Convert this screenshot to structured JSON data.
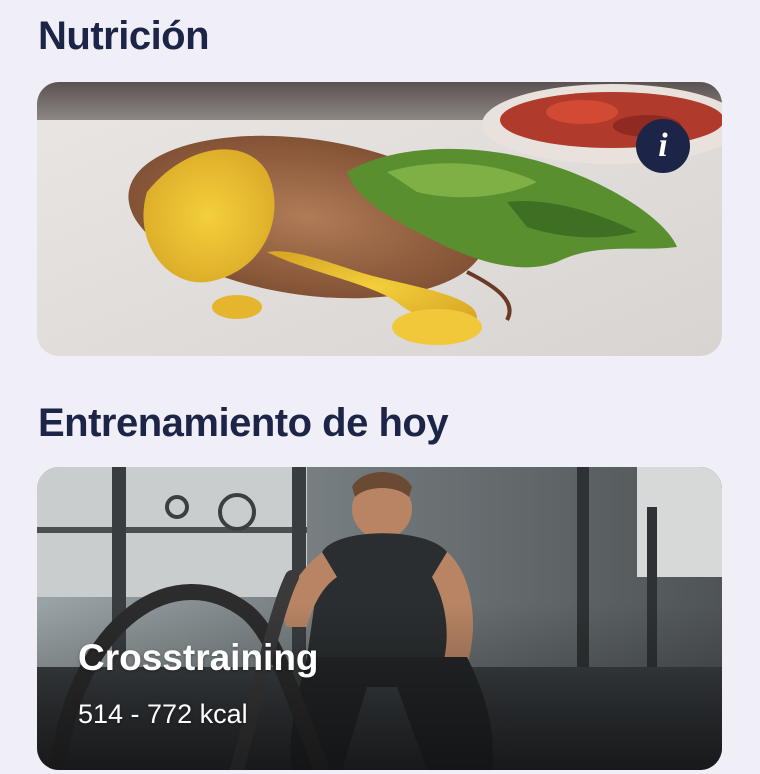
{
  "sections": {
    "nutrition": {
      "title": "Nutrición",
      "image_description": "grilled-chicken-with-sauce-and-salad"
    },
    "workout": {
      "title": "Entrenamiento de hoy",
      "name": "Crosstraining",
      "kcal": "514 - 772 kcal",
      "image_description": "athlete-with-battle-ropes"
    }
  },
  "icons": {
    "info": "info-icon"
  },
  "colors": {
    "background": "#f0eef6",
    "title": "#1c2447",
    "info_button": "#1c2447"
  }
}
